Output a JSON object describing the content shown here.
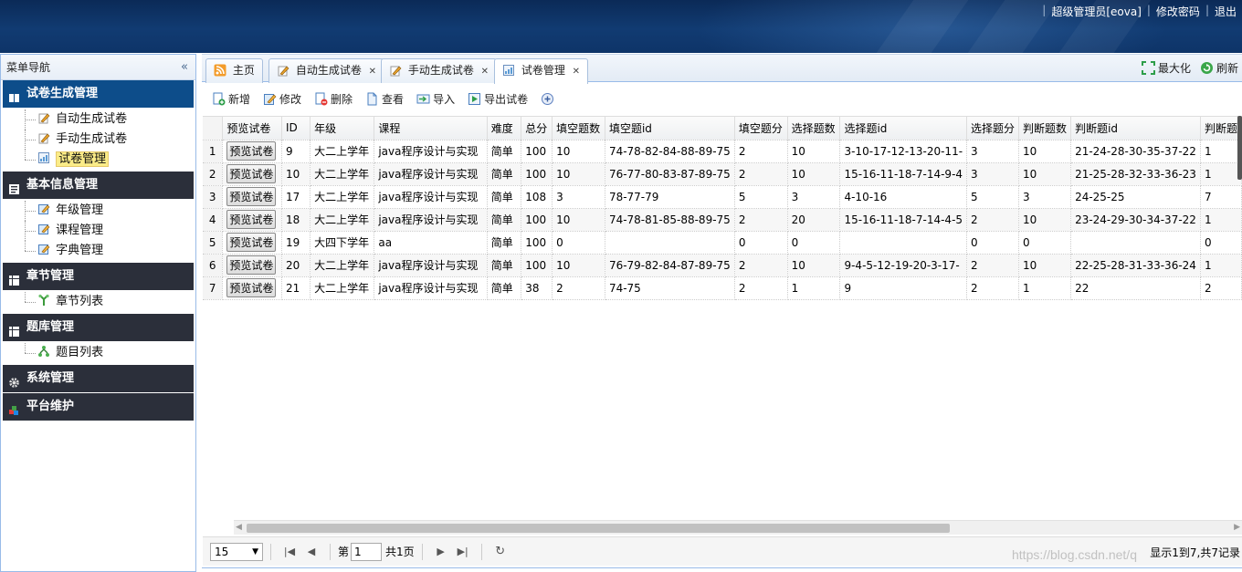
{
  "header": {
    "user_label": "超级管理员[eova]",
    "change_password": "修改密码",
    "logout": "退出"
  },
  "sidebar": {
    "title": "菜单导航",
    "collapse_icon": "double-chevron-left-icon",
    "groups": [
      {
        "label": "试卷生成管理",
        "state": "active",
        "icon": "book-icon",
        "items": [
          {
            "label": "自动生成试卷",
            "icon": "pencil-icon"
          },
          {
            "label": "手动生成试卷",
            "icon": "pencil-icon"
          },
          {
            "label": "试卷管理",
            "icon": "report-icon",
            "selected": true
          }
        ]
      },
      {
        "label": "基本信息管理",
        "icon": "document-icon",
        "items": [
          {
            "label": "年级管理",
            "icon": "edit-icon"
          },
          {
            "label": "课程管理",
            "icon": "edit-icon"
          },
          {
            "label": "字典管理",
            "icon": "edit-icon"
          }
        ]
      },
      {
        "label": "章节管理",
        "icon": "table-icon",
        "items": [
          {
            "label": "章节列表",
            "icon": "branch-icon"
          }
        ]
      },
      {
        "label": "题库管理",
        "icon": "table-icon",
        "items": [
          {
            "label": "题目列表",
            "icon": "hierarchy-icon"
          }
        ]
      },
      {
        "label": "系统管理",
        "icon": "gear-icon",
        "items": []
      },
      {
        "label": "平台维护",
        "icon": "cubes-icon",
        "items": []
      }
    ]
  },
  "tabs": [
    {
      "label": "主页",
      "icon": "rss-icon",
      "closable": false
    },
    {
      "label": "自动生成试卷",
      "icon": "pencil-icon",
      "closable": true
    },
    {
      "label": "手动生成试卷",
      "icon": "pencil-icon",
      "closable": true
    },
    {
      "label": "试卷管理",
      "icon": "report-icon",
      "closable": true,
      "active": true
    }
  ],
  "tab_tools": {
    "maximize": "最大化",
    "refresh": "刷新"
  },
  "toolbar": {
    "add": "新增",
    "edit": "修改",
    "delete": "删除",
    "view": "查看",
    "import": "导入",
    "export": "导出试卷",
    "more_icon": "plus-circle-icon"
  },
  "grid": {
    "columns": [
      "预览试卷",
      "ID",
      "年级",
      "课程",
      "难度",
      "总分",
      "填空题数",
      "填空题id",
      "填空题分",
      "选择题数",
      "选择题id",
      "选择题分",
      "判断题数",
      "判断题id",
      "判断题"
    ],
    "preview_label": "预览试卷",
    "rows": [
      {
        "n": "1",
        "id": "9",
        "grade": "大二上学年",
        "course": "java程序设计与实现",
        "diff": "简单",
        "total": "100",
        "fill_n": "10",
        "fill_id": "74-78-82-84-88-89-75",
        "fill_s": "2",
        "choice_n": "10",
        "choice_id": "3-10-17-12-13-20-11-",
        "choice_s": "3",
        "judge_n": "10",
        "judge_id": "21-24-28-30-35-37-22",
        "judge_s": "1"
      },
      {
        "n": "2",
        "id": "10",
        "grade": "大二上学年",
        "course": "java程序设计与实现",
        "diff": "简单",
        "total": "100",
        "fill_n": "10",
        "fill_id": "76-77-80-83-87-89-75",
        "fill_s": "2",
        "choice_n": "10",
        "choice_id": "15-16-11-18-7-14-9-4",
        "choice_s": "3",
        "judge_n": "10",
        "judge_id": "21-25-28-32-33-36-23",
        "judge_s": "1"
      },
      {
        "n": "3",
        "id": "17",
        "grade": "大二上学年",
        "course": "java程序设计与实现",
        "diff": "简单",
        "total": "108",
        "fill_n": "3",
        "fill_id": "78-77-79",
        "fill_s": "5",
        "choice_n": "3",
        "choice_id": "4-10-16",
        "choice_s": "5",
        "judge_n": "3",
        "judge_id": "24-25-25",
        "judge_s": "7"
      },
      {
        "n": "4",
        "id": "18",
        "grade": "大二上学年",
        "course": "java程序设计与实现",
        "diff": "简单",
        "total": "100",
        "fill_n": "10",
        "fill_id": "74-78-81-85-88-89-75",
        "fill_s": "2",
        "choice_n": "20",
        "choice_id": "15-16-11-18-7-14-4-5",
        "choice_s": "2",
        "judge_n": "10",
        "judge_id": "23-24-29-30-34-37-22",
        "judge_s": "1"
      },
      {
        "n": "5",
        "id": "19",
        "grade": "大四下学年",
        "course": "aa",
        "diff": "简单",
        "total": "100",
        "fill_n": "0",
        "fill_id": "",
        "fill_s": "0",
        "choice_n": "0",
        "choice_id": "",
        "choice_s": "0",
        "judge_n": "0",
        "judge_id": "",
        "judge_s": "0"
      },
      {
        "n": "6",
        "id": "20",
        "grade": "大二上学年",
        "course": "java程序设计与实现",
        "diff": "简单",
        "total": "100",
        "fill_n": "10",
        "fill_id": "76-79-82-84-87-89-75",
        "fill_s": "2",
        "choice_n": "10",
        "choice_id": "9-4-5-12-19-20-3-17-",
        "choice_s": "2",
        "judge_n": "10",
        "judge_id": "22-25-28-31-33-36-24",
        "judge_s": "1"
      },
      {
        "n": "7",
        "id": "21",
        "grade": "大二上学年",
        "course": "java程序设计与实现",
        "diff": "简单",
        "total": "38",
        "fill_n": "2",
        "fill_id": "74-75",
        "fill_s": "2",
        "choice_n": "1",
        "choice_id": "9",
        "choice_s": "2",
        "judge_n": "1",
        "judge_id": "22",
        "judge_s": "2"
      }
    ]
  },
  "pager": {
    "page_size": "15",
    "page_prefix": "第",
    "page_value": "1",
    "page_total": "共1页",
    "info": "显示1到7,共7记录"
  },
  "watermark": "https://blog.csdn.net/q",
  "colors": {
    "header_bg": "#0e3468",
    "active_group": "#0d4d8a",
    "dark_group": "#2b2f3a",
    "border": "#99bbe8"
  }
}
